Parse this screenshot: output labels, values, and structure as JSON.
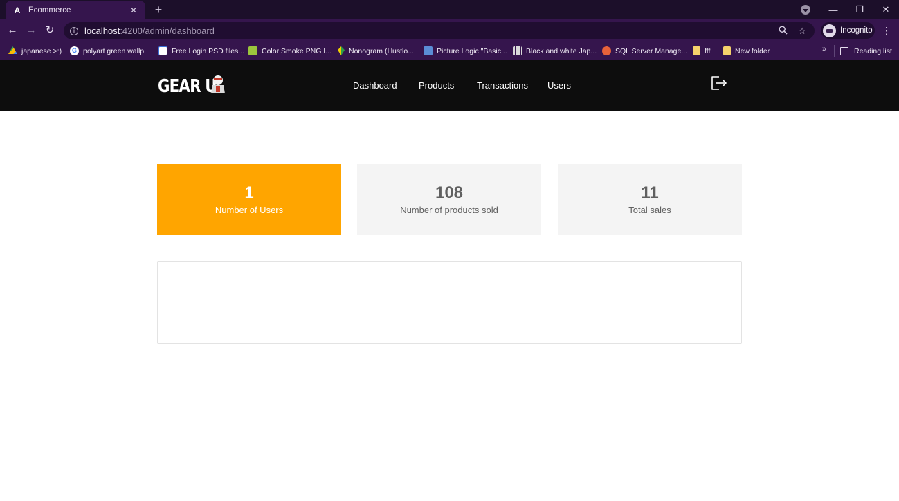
{
  "browser": {
    "tab": {
      "title": "Ecommerce",
      "favicon_letter": "A"
    },
    "new_tab_label": "+",
    "url_host": "localhost",
    "url_path": ":4200/admin/dashboard",
    "profile_label": "Incognito",
    "bookmarks": [
      {
        "label": "japanese >:)",
        "icon": "drive-icon",
        "color": "#34a853"
      },
      {
        "label": "polyart green wallp...",
        "icon": "google-icon",
        "color": "#ffffff"
      },
      {
        "label": "Free Login PSD files...",
        "icon": "square-icon",
        "color": "#3b6fd8"
      },
      {
        "label": "Color Smoke PNG I...",
        "icon": "image-icon",
        "color": "#9bc53d"
      },
      {
        "label": "Nonogram (Illustlo...",
        "icon": "leaf-icon",
        "color": "#f4d000"
      },
      {
        "label": "Picture Logic \"Basic...",
        "icon": "picture-icon",
        "color": "#5b8dd6"
      },
      {
        "label": "Black and white Jap...",
        "icon": "grid-icon",
        "color": "#d9d9d9"
      },
      {
        "label": "SQL Server Manage...",
        "icon": "sql-icon",
        "color": "#e8623a"
      },
      {
        "label": "fff",
        "icon": "folder-icon",
        "color": "#f5d26b"
      },
      {
        "label": "New folder",
        "icon": "folder-icon",
        "color": "#f5d26b"
      }
    ],
    "more_label": "»",
    "reading_list_label": "Reading list"
  },
  "app": {
    "logo_text": "GEAR U",
    "nav": [
      "Dashboard",
      "Products",
      "Transactions",
      "Users"
    ],
    "accent_color": "#ffa500"
  },
  "stats": [
    {
      "value": "1",
      "label": "Number of Users"
    },
    {
      "value": "108",
      "label": "Number of products sold"
    },
    {
      "value": "11",
      "label": "Total sales"
    }
  ]
}
